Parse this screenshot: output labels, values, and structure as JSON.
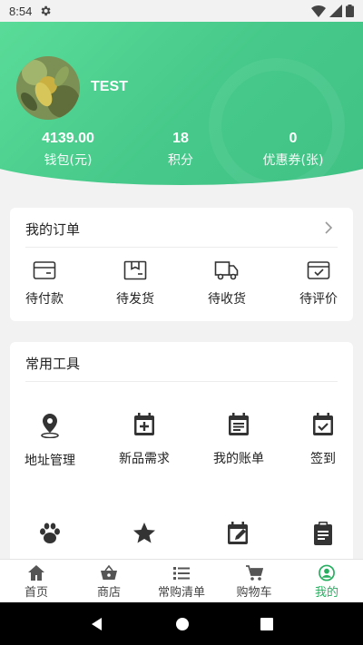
{
  "status_bar": {
    "time": "8:54"
  },
  "profile": {
    "username": "TEST",
    "stats": [
      {
        "value": "4139.00",
        "label": "钱包(元)"
      },
      {
        "value": "18",
        "label": "积分"
      },
      {
        "value": "0",
        "label": "优惠券(张)"
      }
    ]
  },
  "orders": {
    "title": "我的订单",
    "items": [
      {
        "label": "待付款",
        "icon": "card-icon"
      },
      {
        "label": "待发货",
        "icon": "box-icon"
      },
      {
        "label": "待收货",
        "icon": "truck-icon"
      },
      {
        "label": "待评价",
        "icon": "review-icon"
      }
    ]
  },
  "tools": {
    "title": "常用工具",
    "items": [
      {
        "label": "地址管理",
        "icon": "location-icon"
      },
      {
        "label": "新品需求",
        "icon": "calendar-plus-icon"
      },
      {
        "label": "我的账单",
        "icon": "calendar-list-icon"
      },
      {
        "label": "签到",
        "icon": "calendar-check-icon"
      },
      {
        "label": "",
        "icon": "paw-icon"
      },
      {
        "label": "",
        "icon": "star-icon"
      },
      {
        "label": "",
        "icon": "calendar-edit-icon"
      },
      {
        "label": "",
        "icon": "clipboard-icon"
      }
    ]
  },
  "bottom_nav": {
    "items": [
      {
        "label": "首页",
        "icon": "home-icon"
      },
      {
        "label": "商店",
        "icon": "shop-basket-icon"
      },
      {
        "label": "常购清单",
        "icon": "list-icon"
      },
      {
        "label": "购物车",
        "icon": "cart-icon"
      },
      {
        "label": "我的",
        "icon": "user-circle-icon"
      }
    ],
    "active_index": 4
  },
  "colors": {
    "accent": "#3fc184",
    "active_tab": "#27ae60",
    "icon_dark": "#333333"
  }
}
